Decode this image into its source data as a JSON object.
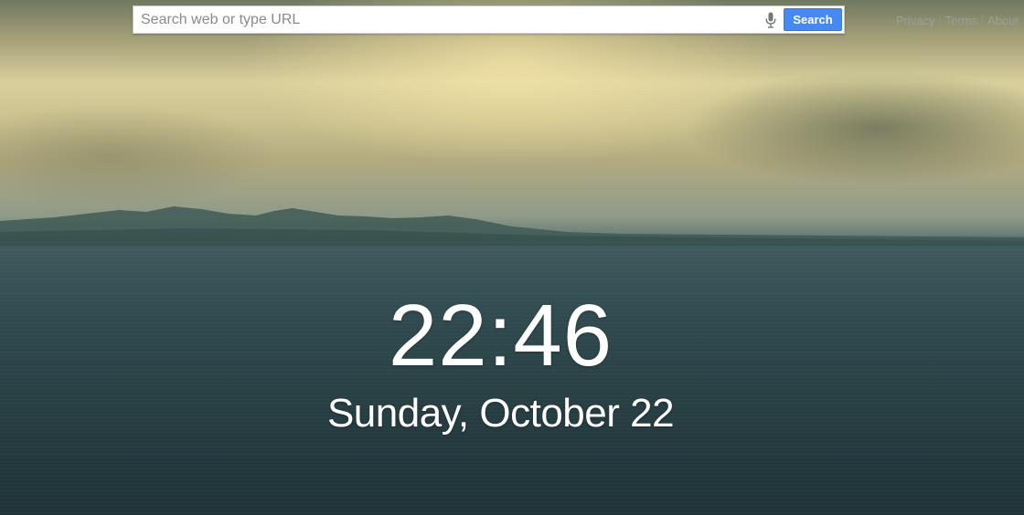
{
  "search": {
    "placeholder": "Search web or type URL",
    "button_label": "Search",
    "mic_icon": "microphone-icon"
  },
  "links": {
    "privacy": "Privacy",
    "terms": "Terms",
    "about": "About"
  },
  "clock": {
    "time": "22:46",
    "date": "Sunday, October 22"
  },
  "colors": {
    "accent": "#4889f1",
    "link_text": "#9aa097",
    "clock_text": "#ffffff"
  }
}
